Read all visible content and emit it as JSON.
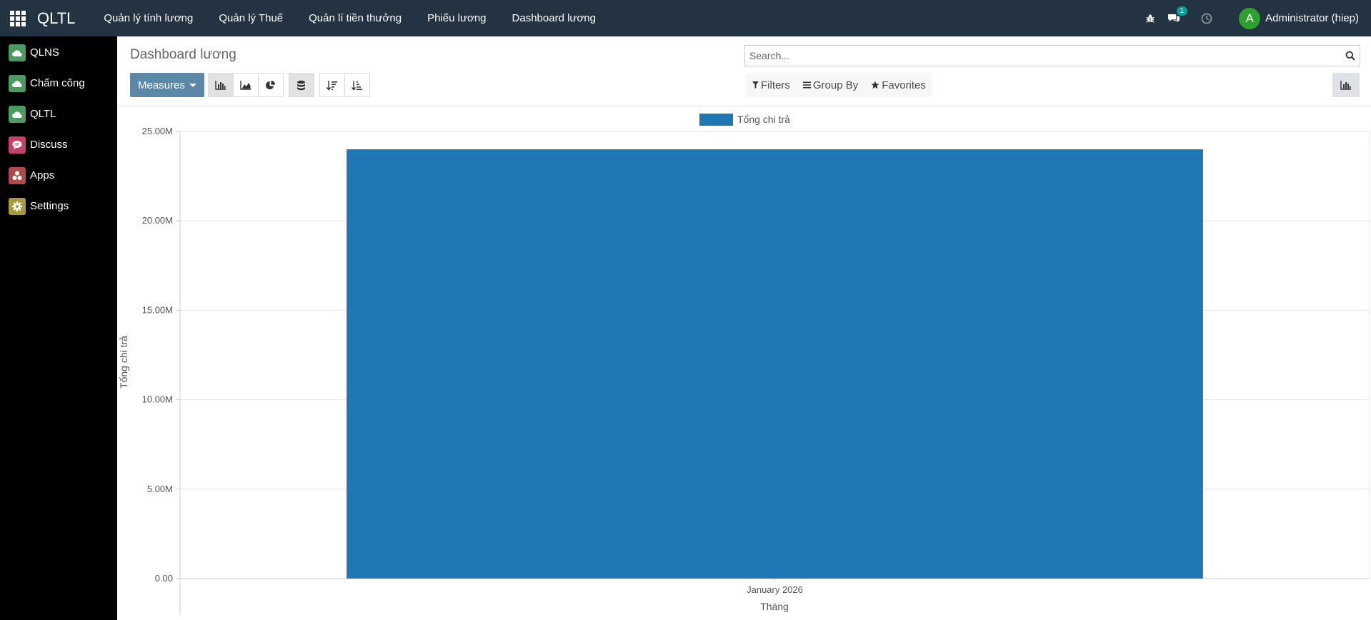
{
  "app": {
    "name": "QLTL"
  },
  "topmenu": [
    {
      "label": "Quản lý tính lương"
    },
    {
      "label": "Quản lý Thuế"
    },
    {
      "label": "Quản lí tiền thưởng"
    },
    {
      "label": "Phiếu lương"
    },
    {
      "label": "Dashboard lương"
    }
  ],
  "systray": {
    "messages_count": "1"
  },
  "user": {
    "initial": "A",
    "name": "Administrator (hiep)"
  },
  "sidebar": {
    "items": [
      {
        "label": "QLNS",
        "icon": "cloud-icon",
        "color": "#4c9a5f"
      },
      {
        "label": "Chấm công",
        "icon": "cloud-icon",
        "color": "#4c9a5f"
      },
      {
        "label": "QLTL",
        "icon": "cloud-icon",
        "color": "#4c9a5f"
      },
      {
        "label": "Discuss",
        "icon": "chat-bubble-icon",
        "color": "#c5416b"
      },
      {
        "label": "Apps",
        "icon": "apps-cubes-icon",
        "color": "#b04a4a"
      },
      {
        "label": "Settings",
        "icon": "gear-icon",
        "color": "#a39c3c"
      }
    ]
  },
  "page": {
    "title": "Dashboard lương",
    "search_placeholder": "Search...",
    "measures_label": "Measures",
    "filters_label": "Filters",
    "groupby_label": "Group By",
    "favorites_label": "Favorites"
  },
  "chart_data": {
    "type": "bar",
    "categories": [
      "January 2026"
    ],
    "series": [
      {
        "name": "Tổng chi trả",
        "values": [
          24000000
        ],
        "color": "#1f77b4"
      }
    ],
    "xlabel": "Tháng",
    "ylabel": "Tổng chi trả",
    "ylim": [
      0,
      25000000
    ],
    "yticks": [
      0,
      5000000,
      10000000,
      15000000,
      20000000,
      25000000
    ],
    "ytick_labels": [
      "0.00",
      "5.00M",
      "10.00M",
      "15.00M",
      "20.00M",
      "25.00M"
    ],
    "grid": true,
    "legend": "top-center"
  }
}
